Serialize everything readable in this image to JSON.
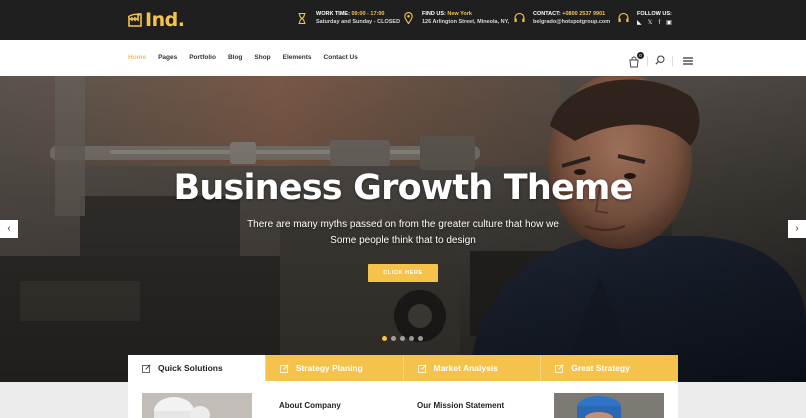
{
  "brand": {
    "name": "Ind",
    "dot": "."
  },
  "topbar": {
    "work_time": {
      "label": "WORK TIME:",
      "hours": "09:00 - 17:00",
      "closed": "Saturday and Sunday - CLOSED"
    },
    "find_us": {
      "label": "FIND US:",
      "city": "New York",
      "address": "126 Arlington Street, Mineola, NY,"
    },
    "contact": {
      "label": "CONTACT:",
      "phone": "+0800 2537 9901",
      "email": "belgrado@hotspotgroup.com"
    },
    "follow": {
      "label": "FOLLOW US:"
    }
  },
  "nav": {
    "items": [
      "Home",
      "Pages",
      "Portfolio",
      "Blog",
      "Shop",
      "Elements",
      "Contact Us"
    ],
    "cart_count": "0"
  },
  "hero": {
    "title": "Business Growth Theme",
    "subtitle": "There are many myths passed on from the greater culture that how we Some people think that to design",
    "cta": "CLICK HERE",
    "slide_count": 5,
    "active_slide": 1
  },
  "tabs": [
    "Quick Solutions",
    "Strategy Planing",
    "Market Analysis",
    "Great Strategy"
  ],
  "content": {
    "about_title": "About Company",
    "mission_title": "Our Mission Statement"
  },
  "colors": {
    "accent": "#f5c34b",
    "topbar": "#1f1f1f"
  }
}
